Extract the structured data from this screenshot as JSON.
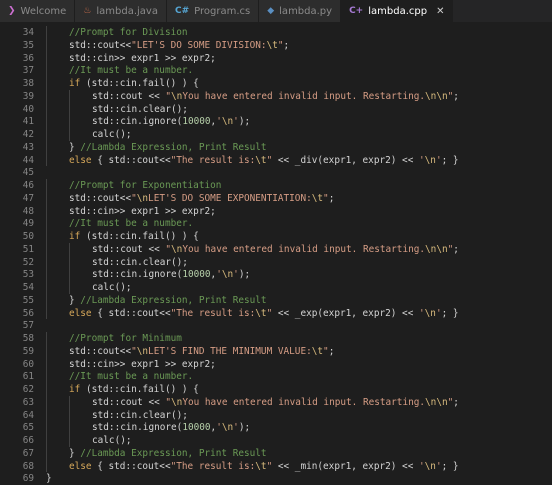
{
  "tabs": [
    {
      "label": "Welcome",
      "icon": "vscode-icon",
      "active": false
    },
    {
      "label": "lambda.java",
      "icon": "java-file-icon",
      "active": false
    },
    {
      "label": "Program.cs",
      "icon": "csharp-file-icon",
      "active": false
    },
    {
      "label": "lambda.py",
      "icon": "python-file-icon",
      "active": false
    },
    {
      "label": "lambda.cpp",
      "icon": "cpp-file-icon",
      "active": true
    }
  ],
  "colors": {
    "background": "#1e1e1e",
    "comment": "#6a9955",
    "keyword": "#d6a85a",
    "string": "#d69d85",
    "line_number": "#858585"
  },
  "editor": {
    "lines": [
      {
        "n": "34",
        "indent": 1,
        "tokens": [
          [
            "comment",
            "//Prompt for Division"
          ]
        ]
      },
      {
        "n": "35",
        "indent": 1,
        "tokens": [
          [
            "plain",
            "std::cout<<"
          ],
          [
            "string",
            "\"LET'S DO SOME DIVISION:"
          ],
          [
            "escape",
            "\\t"
          ],
          [
            "string",
            "\""
          ],
          [
            "plain",
            ";"
          ]
        ]
      },
      {
        "n": "36",
        "indent": 1,
        "tokens": [
          [
            "plain",
            "std::cin>> expr1 >> expr2;"
          ]
        ]
      },
      {
        "n": "37",
        "indent": 1,
        "tokens": [
          [
            "comment",
            "//It must be a number."
          ]
        ]
      },
      {
        "n": "38",
        "indent": 1,
        "tokens": [
          [
            "keyword",
            "if"
          ],
          [
            "plain",
            " (std::cin.fail() ) {"
          ]
        ]
      },
      {
        "n": "39",
        "indent": 2,
        "tokens": [
          [
            "plain",
            "std::cout << "
          ],
          [
            "string",
            "\""
          ],
          [
            "escape",
            "\\n"
          ],
          [
            "string",
            "You have entered invalid input. Restarting."
          ],
          [
            "escape",
            "\\n\\n"
          ],
          [
            "string",
            "\""
          ],
          [
            "plain",
            ";"
          ]
        ]
      },
      {
        "n": "40",
        "indent": 2,
        "tokens": [
          [
            "plain",
            "std::cin.clear();"
          ]
        ]
      },
      {
        "n": "41",
        "indent": 2,
        "tokens": [
          [
            "plain",
            "std::cin.ignore("
          ],
          [
            "number",
            "10000"
          ],
          [
            "plain",
            ","
          ],
          [
            "string",
            "'"
          ],
          [
            "escape",
            "\\n"
          ],
          [
            "string",
            "'"
          ],
          [
            "plain",
            ");"
          ]
        ]
      },
      {
        "n": "42",
        "indent": 2,
        "tokens": [
          [
            "plain",
            "calc();"
          ]
        ]
      },
      {
        "n": "43",
        "indent": 1,
        "tokens": [
          [
            "plain",
            "} "
          ],
          [
            "comment",
            "//Lambda Expression, Print Result"
          ]
        ]
      },
      {
        "n": "44",
        "indent": 1,
        "tokens": [
          [
            "keyword",
            "else"
          ],
          [
            "plain",
            " { std::cout<<"
          ],
          [
            "string",
            "\"The result is:"
          ],
          [
            "escape",
            "\\t"
          ],
          [
            "string",
            "\""
          ],
          [
            "plain",
            " << _div(expr1, expr2) << "
          ],
          [
            "string",
            "'"
          ],
          [
            "escape",
            "\\n"
          ],
          [
            "string",
            "'"
          ],
          [
            "plain",
            "; }"
          ]
        ]
      },
      {
        "n": "45",
        "indent": 0,
        "tokens": []
      },
      {
        "n": "46",
        "indent": 1,
        "tokens": [
          [
            "comment",
            "//Prompt for Exponentiation"
          ]
        ]
      },
      {
        "n": "47",
        "indent": 1,
        "tokens": [
          [
            "plain",
            "std::cout<<"
          ],
          [
            "string",
            "\""
          ],
          [
            "escape",
            "\\n"
          ],
          [
            "string",
            "LET'S DO SOME EXPONENTIATION:"
          ],
          [
            "escape",
            "\\t"
          ],
          [
            "string",
            "\""
          ],
          [
            "plain",
            ";"
          ]
        ]
      },
      {
        "n": "48",
        "indent": 1,
        "tokens": [
          [
            "plain",
            "std::cin>> expr1 >> expr2;"
          ]
        ]
      },
      {
        "n": "49",
        "indent": 1,
        "tokens": [
          [
            "comment",
            "//It must be a number."
          ]
        ]
      },
      {
        "n": "50",
        "indent": 1,
        "tokens": [
          [
            "keyword",
            "if"
          ],
          [
            "plain",
            " (std::cin.fail() ) {"
          ]
        ]
      },
      {
        "n": "51",
        "indent": 2,
        "tokens": [
          [
            "plain",
            "std::cout << "
          ],
          [
            "string",
            "\""
          ],
          [
            "escape",
            "\\n"
          ],
          [
            "string",
            "You have entered invalid input. Restarting."
          ],
          [
            "escape",
            "\\n\\n"
          ],
          [
            "string",
            "\""
          ],
          [
            "plain",
            ";"
          ]
        ]
      },
      {
        "n": "52",
        "indent": 2,
        "tokens": [
          [
            "plain",
            "std::cin.clear();"
          ]
        ]
      },
      {
        "n": "53",
        "indent": 2,
        "tokens": [
          [
            "plain",
            "std::cin.ignore("
          ],
          [
            "number",
            "10000"
          ],
          [
            "plain",
            ","
          ],
          [
            "string",
            "'"
          ],
          [
            "escape",
            "\\n"
          ],
          [
            "string",
            "'"
          ],
          [
            "plain",
            ");"
          ]
        ]
      },
      {
        "n": "54",
        "indent": 2,
        "tokens": [
          [
            "plain",
            "calc();"
          ]
        ]
      },
      {
        "n": "55",
        "indent": 1,
        "tokens": [
          [
            "plain",
            "} "
          ],
          [
            "comment",
            "//Lambda Expression, Print Result"
          ]
        ]
      },
      {
        "n": "56",
        "indent": 1,
        "tokens": [
          [
            "keyword",
            "else"
          ],
          [
            "plain",
            " { std::cout<<"
          ],
          [
            "string",
            "\"The result is:"
          ],
          [
            "escape",
            "\\t"
          ],
          [
            "string",
            "\""
          ],
          [
            "plain",
            " << _exp(expr1, expr2) << "
          ],
          [
            "string",
            "'"
          ],
          [
            "escape",
            "\\n"
          ],
          [
            "string",
            "'"
          ],
          [
            "plain",
            "; }"
          ]
        ]
      },
      {
        "n": "57",
        "indent": 0,
        "tokens": []
      },
      {
        "n": "58",
        "indent": 1,
        "tokens": [
          [
            "comment",
            "//Prompt for Minimum"
          ]
        ]
      },
      {
        "n": "59",
        "indent": 1,
        "tokens": [
          [
            "plain",
            "std::cout<<"
          ],
          [
            "string",
            "\""
          ],
          [
            "escape",
            "\\n"
          ],
          [
            "string",
            "LET'S FIND THE MINIMUM VALUE:"
          ],
          [
            "escape",
            "\\t"
          ],
          [
            "string",
            "\""
          ],
          [
            "plain",
            ";"
          ]
        ]
      },
      {
        "n": "60",
        "indent": 1,
        "tokens": [
          [
            "plain",
            "std::cin>> expr1 >> expr2;"
          ]
        ]
      },
      {
        "n": "61",
        "indent": 1,
        "tokens": [
          [
            "comment",
            "//It must be a number."
          ]
        ]
      },
      {
        "n": "62",
        "indent": 1,
        "tokens": [
          [
            "keyword",
            "if"
          ],
          [
            "plain",
            " (std::cin.fail() ) {"
          ]
        ]
      },
      {
        "n": "63",
        "indent": 2,
        "tokens": [
          [
            "plain",
            "std::cout << "
          ],
          [
            "string",
            "\""
          ],
          [
            "escape",
            "\\n"
          ],
          [
            "string",
            "You have entered invalid input. Restarting."
          ],
          [
            "escape",
            "\\n\\n"
          ],
          [
            "string",
            "\""
          ],
          [
            "plain",
            ";"
          ]
        ]
      },
      {
        "n": "64",
        "indent": 2,
        "tokens": [
          [
            "plain",
            "std::cin.clear();"
          ]
        ]
      },
      {
        "n": "65",
        "indent": 2,
        "tokens": [
          [
            "plain",
            "std::cin.ignore("
          ],
          [
            "number",
            "10000"
          ],
          [
            "plain",
            ","
          ],
          [
            "string",
            "'"
          ],
          [
            "escape",
            "\\n"
          ],
          [
            "string",
            "'"
          ],
          [
            "plain",
            ");"
          ]
        ]
      },
      {
        "n": "66",
        "indent": 2,
        "tokens": [
          [
            "plain",
            "calc();"
          ]
        ]
      },
      {
        "n": "67",
        "indent": 1,
        "tokens": [
          [
            "plain",
            "} "
          ],
          [
            "comment",
            "//Lambda Expression, Print Result"
          ]
        ]
      },
      {
        "n": "68",
        "indent": 1,
        "tokens": [
          [
            "keyword",
            "else"
          ],
          [
            "plain",
            " { std::cout<<"
          ],
          [
            "string",
            "\"The result is:"
          ],
          [
            "escape",
            "\\t"
          ],
          [
            "string",
            "\""
          ],
          [
            "plain",
            " << _min(expr1, expr2) << "
          ],
          [
            "string",
            "'"
          ],
          [
            "escape",
            "\\n"
          ],
          [
            "string",
            "'"
          ],
          [
            "plain",
            "; }"
          ]
        ]
      },
      {
        "n": "69",
        "indent": 0,
        "tokens": [
          [
            "plain",
            "}"
          ]
        ]
      }
    ]
  }
}
